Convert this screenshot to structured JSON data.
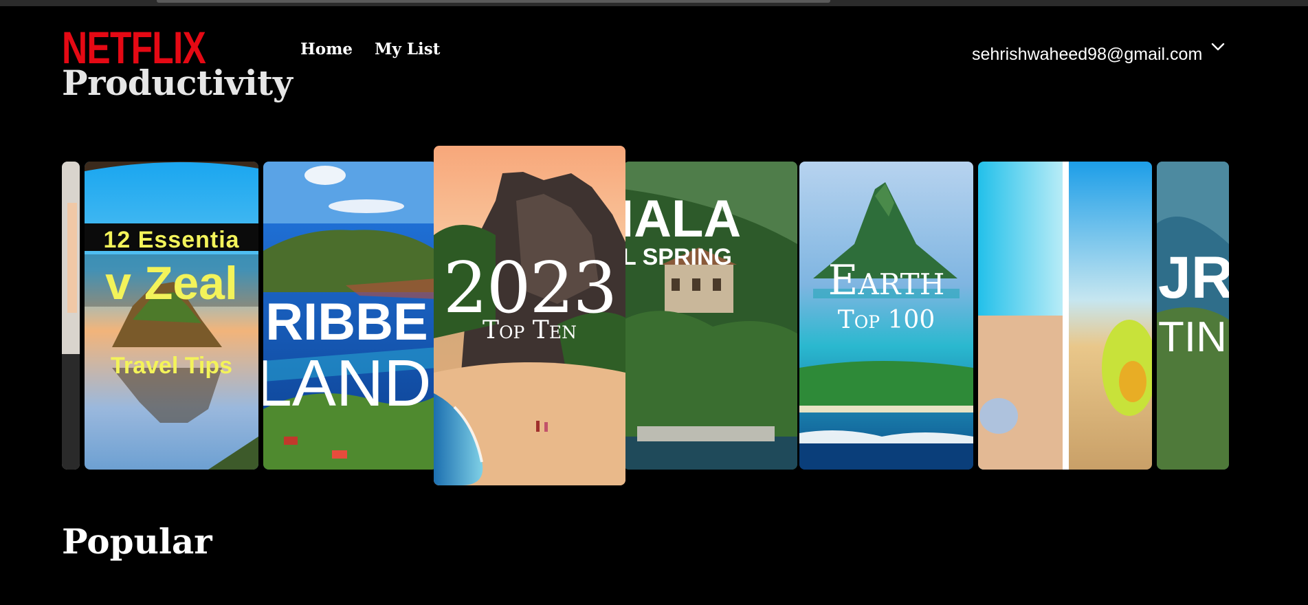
{
  "brand": {
    "logo_text": "NETFLIX",
    "subtitle": "Productivity",
    "logo_color": "#e50914"
  },
  "nav": {
    "home": "Home",
    "my_list": "My List"
  },
  "account": {
    "email": "sehrishwaheed98@gmail.com"
  },
  "cards": [
    {
      "id": "nz",
      "line1": "12 Essentia",
      "line2": "v Zeal",
      "line3": "Travel Tips"
    },
    {
      "id": "caribbean",
      "line1": "RIBBE",
      "line2": "LAND"
    },
    {
      "id": "top2023",
      "line1": "2023",
      "line2": "Top Ten"
    },
    {
      "id": "guatemala",
      "line1": "IALA",
      "line2": "L SPRING"
    },
    {
      "id": "earth",
      "line1": "Earth",
      "line2": "Top 100"
    },
    {
      "id": "beach"
    },
    {
      "id": "partial",
      "line1": "JR",
      "line2": "TIN"
    }
  ],
  "section": {
    "popular": "Popular"
  },
  "colors": {
    "background": "#000000",
    "text": "#ffffff",
    "subtitle": "#e6e6e6"
  }
}
